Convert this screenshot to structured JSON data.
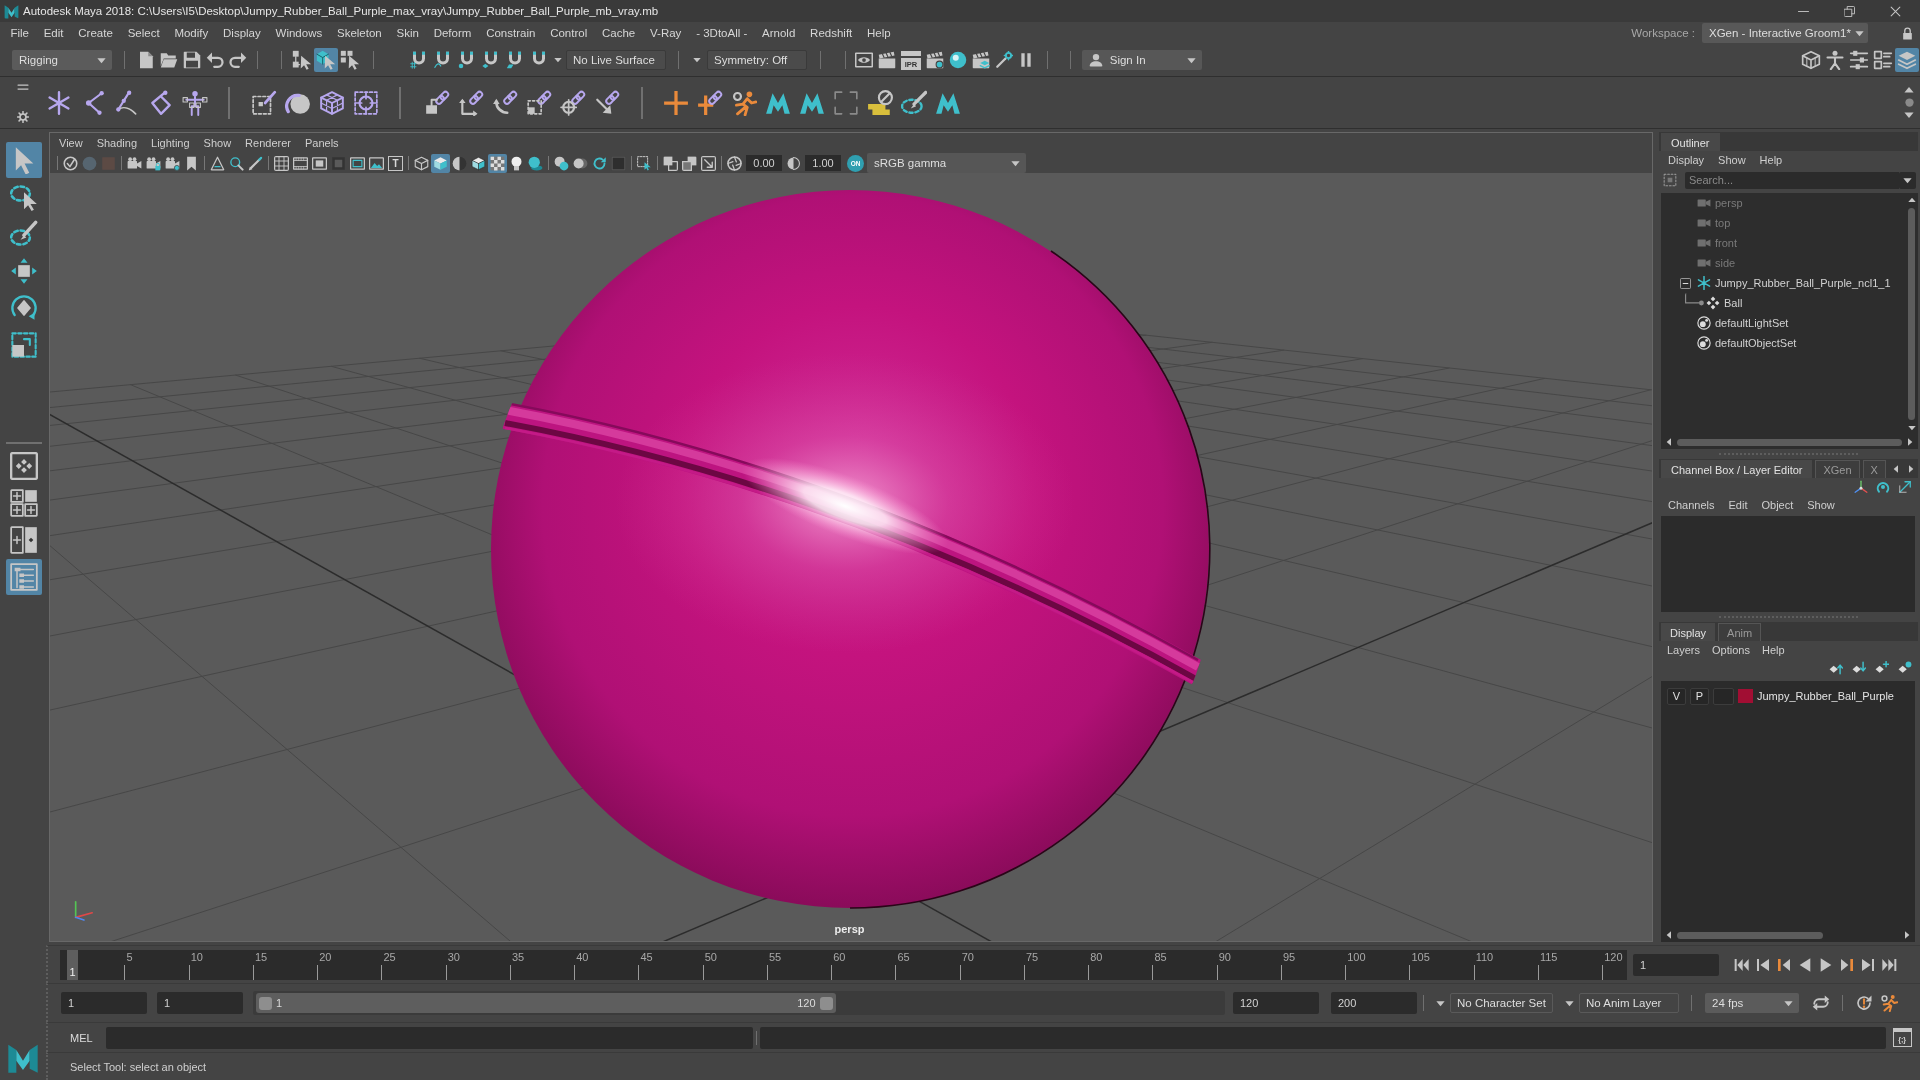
{
  "window": {
    "title": "Autodesk Maya 2018: C:\\Users\\I5\\Desktop\\Jumpy_Rubber_Ball_Purple_max_vray\\Jumpy_Rubber_Ball_Purple_mb_vray.mb"
  },
  "menu_bar": [
    "File",
    "Edit",
    "Create",
    "Select",
    "Modify",
    "Display",
    "Windows",
    "Skeleton",
    "Skin",
    "Deform",
    "Constrain",
    "Control",
    "Cache",
    "V-Ray",
    "- 3DtoAll -",
    "Arnold",
    "Redshift",
    "Help"
  ],
  "workspace": {
    "label": "Workspace :",
    "value": "XGen - Interactive Groom1*"
  },
  "status_line": {
    "menu_set": "Rigging",
    "selection_mode": [
      {
        "kind": "hierarchy",
        "on": false
      },
      {
        "kind": "object",
        "on": true
      },
      {
        "kind": "component",
        "on": false
      }
    ],
    "live_surface": "No Live Surface",
    "symmetry": "Symmetry: Off",
    "ipr_label": "IPR",
    "sign_in": "Sign In",
    "panel_toggles": [
      {
        "kind": "toolkit",
        "on": false
      },
      {
        "kind": "figure",
        "on": false
      },
      {
        "kind": "settings",
        "on": false
      },
      {
        "kind": "attributes",
        "on": false
      },
      {
        "kind": "channels",
        "on": true
      }
    ]
  },
  "toolbox": {
    "tools": [
      {
        "kind": "select",
        "selected": true
      },
      {
        "kind": "lasso",
        "selected": false
      },
      {
        "kind": "paint",
        "selected": false
      },
      {
        "kind": "move",
        "selected": false
      },
      {
        "kind": "rotate",
        "selected": false
      },
      {
        "kind": "scale",
        "selected": false
      }
    ],
    "layouts": [
      {
        "kind": "single",
        "selected": false
      },
      {
        "kind": "quad",
        "selected": false
      },
      {
        "kind": "split",
        "selected": false
      },
      {
        "kind": "outliner",
        "selected": true
      }
    ]
  },
  "viewport": {
    "menu": [
      "View",
      "Shading",
      "Lighting",
      "Show",
      "Renderer",
      "Panels"
    ],
    "toolbar": [
      [
        {
          "kind": "check",
          "on": false
        },
        {
          "kind": "sphere",
          "on": false
        },
        {
          "kind": "square",
          "on": false
        }
      ],
      [
        {
          "kind": "camera",
          "on": false
        },
        {
          "kind": "cameralock",
          "on": false
        },
        {
          "kind": "cameragear",
          "on": false
        },
        {
          "kind": "bookmark",
          "on": false
        }
      ],
      [
        {
          "kind": "ruler",
          "on": false
        },
        {
          "kind": "panzoom",
          "on": false
        },
        {
          "kind": "pencil",
          "on": false
        }
      ],
      [
        {
          "kind": "grid",
          "on": false
        },
        {
          "kind": "film",
          "on": false
        },
        {
          "kind": "gate",
          "on": false
        },
        {
          "kind": "field",
          "on": false
        },
        {
          "kind": "safe",
          "on": false
        },
        {
          "kind": "image",
          "on": false
        },
        {
          "kind": "text",
          "label": "T",
          "on": false
        }
      ],
      [
        {
          "kind": "wire",
          "on": false
        },
        {
          "kind": "shaded",
          "on": true
        },
        {
          "kind": "halfsphere",
          "on": false
        },
        {
          "kind": "wireshaded",
          "on": false
        },
        {
          "kind": "checker",
          "on": true
        },
        {
          "kind": "bulb",
          "on": false
        },
        {
          "kind": "shadow",
          "on": false
        }
      ],
      [
        {
          "kind": "occlusion",
          "on": false
        },
        {
          "kind": "blur",
          "on": false
        },
        {
          "kind": "ring",
          "on": false
        },
        {
          "kind": "antialias",
          "on": false
        }
      ],
      [
        {
          "kind": "isolate",
          "on": false
        }
      ],
      [
        {
          "kind": "xray",
          "on": false
        },
        {
          "kind": "xrayjoint",
          "on": false
        },
        {
          "kind": "frame",
          "on": false
        }
      ],
      [
        {
          "kind": "exposure",
          "on": false
        }
      ]
    ],
    "exposure": "0.00",
    "gamma": "1.00",
    "color_management": {
      "label": "ON",
      "on": true
    },
    "view_transform": "sRGB gamma",
    "camera_label": "persp"
  },
  "outliner": {
    "title": "Outliner",
    "menu": [
      "Display",
      "Show",
      "Help"
    ],
    "search": {
      "placeholder": "Search..."
    },
    "items": [
      {
        "label": "persp",
        "kind": "camera",
        "dimmed": true
      },
      {
        "label": "top",
        "kind": "camera",
        "dimmed": true
      },
      {
        "label": "front",
        "kind": "camera",
        "dimmed": true
      },
      {
        "label": "side",
        "kind": "camera",
        "dimmed": true
      },
      {
        "label": "Jumpy_Rubber_Ball_Purple_ncl1_1",
        "kind": "nucleus",
        "dimmed": false,
        "expanded": true,
        "children": [
          {
            "label": "Ball",
            "kind": "mesh",
            "dimmed": false
          }
        ]
      },
      {
        "label": "defaultLightSet",
        "kind": "set",
        "dimmed": false
      },
      {
        "label": "defaultObjectSet",
        "kind": "set",
        "dimmed": false
      }
    ]
  },
  "channel_box": {
    "tabs": [
      {
        "label": "Channel Box / Layer Editor",
        "selected": true
      },
      {
        "label": "XGen",
        "selected": false
      },
      {
        "label": "X",
        "selected": false
      }
    ],
    "menu": [
      "Channels",
      "Edit",
      "Object",
      "Show"
    ]
  },
  "layer_editor": {
    "tabs": [
      {
        "label": "Display",
        "selected": true
      },
      {
        "label": "Anim",
        "selected": false
      }
    ],
    "menu": [
      "Layers",
      "Options",
      "Help"
    ],
    "layers": [
      {
        "visibility": "V",
        "playback": "P",
        "name": "Jumpy_Rubber_Ball_Purple",
        "color": "#a10e33"
      }
    ]
  },
  "time_slider": {
    "ticks": [
      "5",
      "10",
      "15",
      "20",
      "25",
      "30",
      "35",
      "40",
      "45",
      "50",
      "55",
      "60",
      "65",
      "70",
      "75",
      "80",
      "85",
      "90",
      "95",
      "100",
      "105",
      "110",
      "115",
      "120"
    ],
    "current_frame": "1",
    "level": 0,
    "frame_field": "1"
  },
  "range_slider": {
    "start": "1",
    "playback_start": "1",
    "handle_start": "1",
    "handle_end": "120",
    "level": 0.6,
    "playback_end": "120",
    "end": "200",
    "character_set": "No Character Set",
    "anim_layer": "No Anim Layer",
    "fps": "24 fps"
  },
  "command_line": {
    "language": "MEL",
    "script_editor_label": "{;}"
  },
  "help_line": "Select Tool: select an object"
}
